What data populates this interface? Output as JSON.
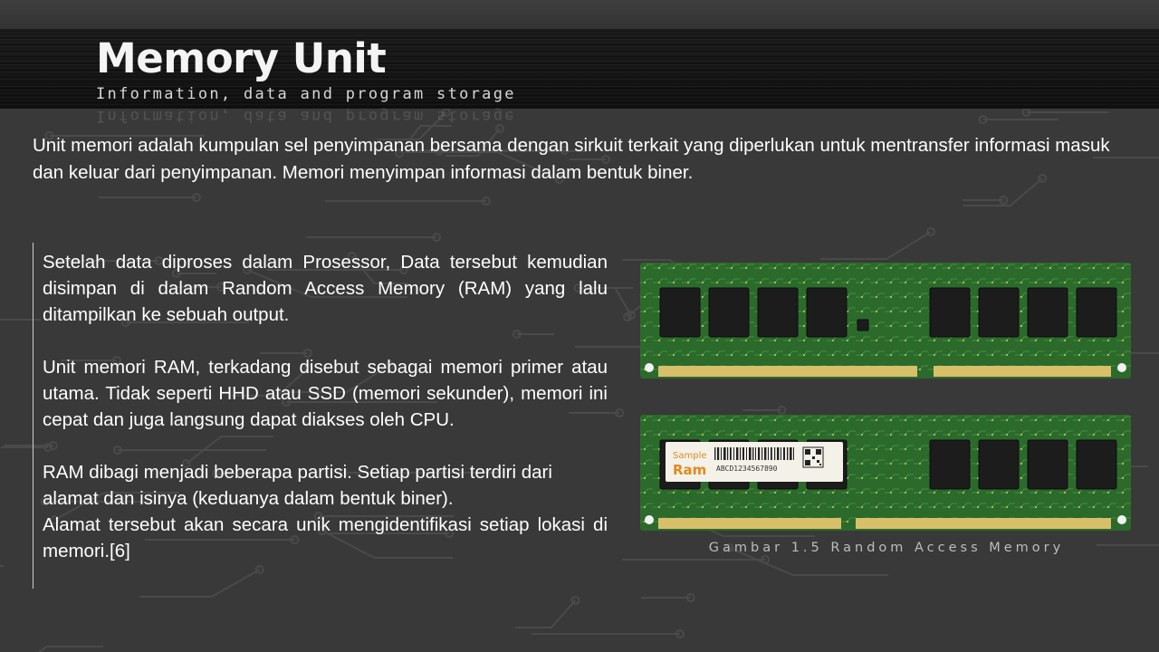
{
  "slide": {
    "title": "Memory Unit",
    "subtitle": "Information, data and program storage",
    "intro": "Unit memori adalah kumpulan sel penyimpanan bersama dengan sirkuit terkait yang diperlukan untuk mentransfer informasi masuk dan keluar dari penyimpanan. Memori menyimpan informasi dalam bentuk biner.",
    "paragraphs": {
      "p1": "Setelah data diproses dalam Prosessor, Data tersebut kemudian disimpan di dalam Random Access Memory (RAM) yang lalu ditampilkan ke sebuah output.",
      "p2": "Unit memori RAM, terkadang disebut sebagai memori primer atau utama. Tidak seperti HHD atau SSD (memori sekunder), memori ini cepat dan juga langsung dapat diakses oleh CPU.",
      "p3a": "RAM dibagi menjadi beberapa partisi. Setiap partisi terdiri dari alamat dan isinya (keduanya dalam bentuk biner).",
      "p3b": "Alamat tersebut akan secara unik mengidentifikasi setiap lokasi di memori.[6]"
    },
    "figure": {
      "caption": "Gambar 1.5 Random Access Memory",
      "sticker_line1": "Sample",
      "sticker_line2": "Ram",
      "sticker_serial": "ABCD1234567890"
    }
  },
  "colors": {
    "background": "#393939",
    "header_band": "#141414",
    "pcb_green": "#2b6a2b",
    "chip": "#1c1c1c",
    "gold_contacts": "#d8c06a"
  }
}
